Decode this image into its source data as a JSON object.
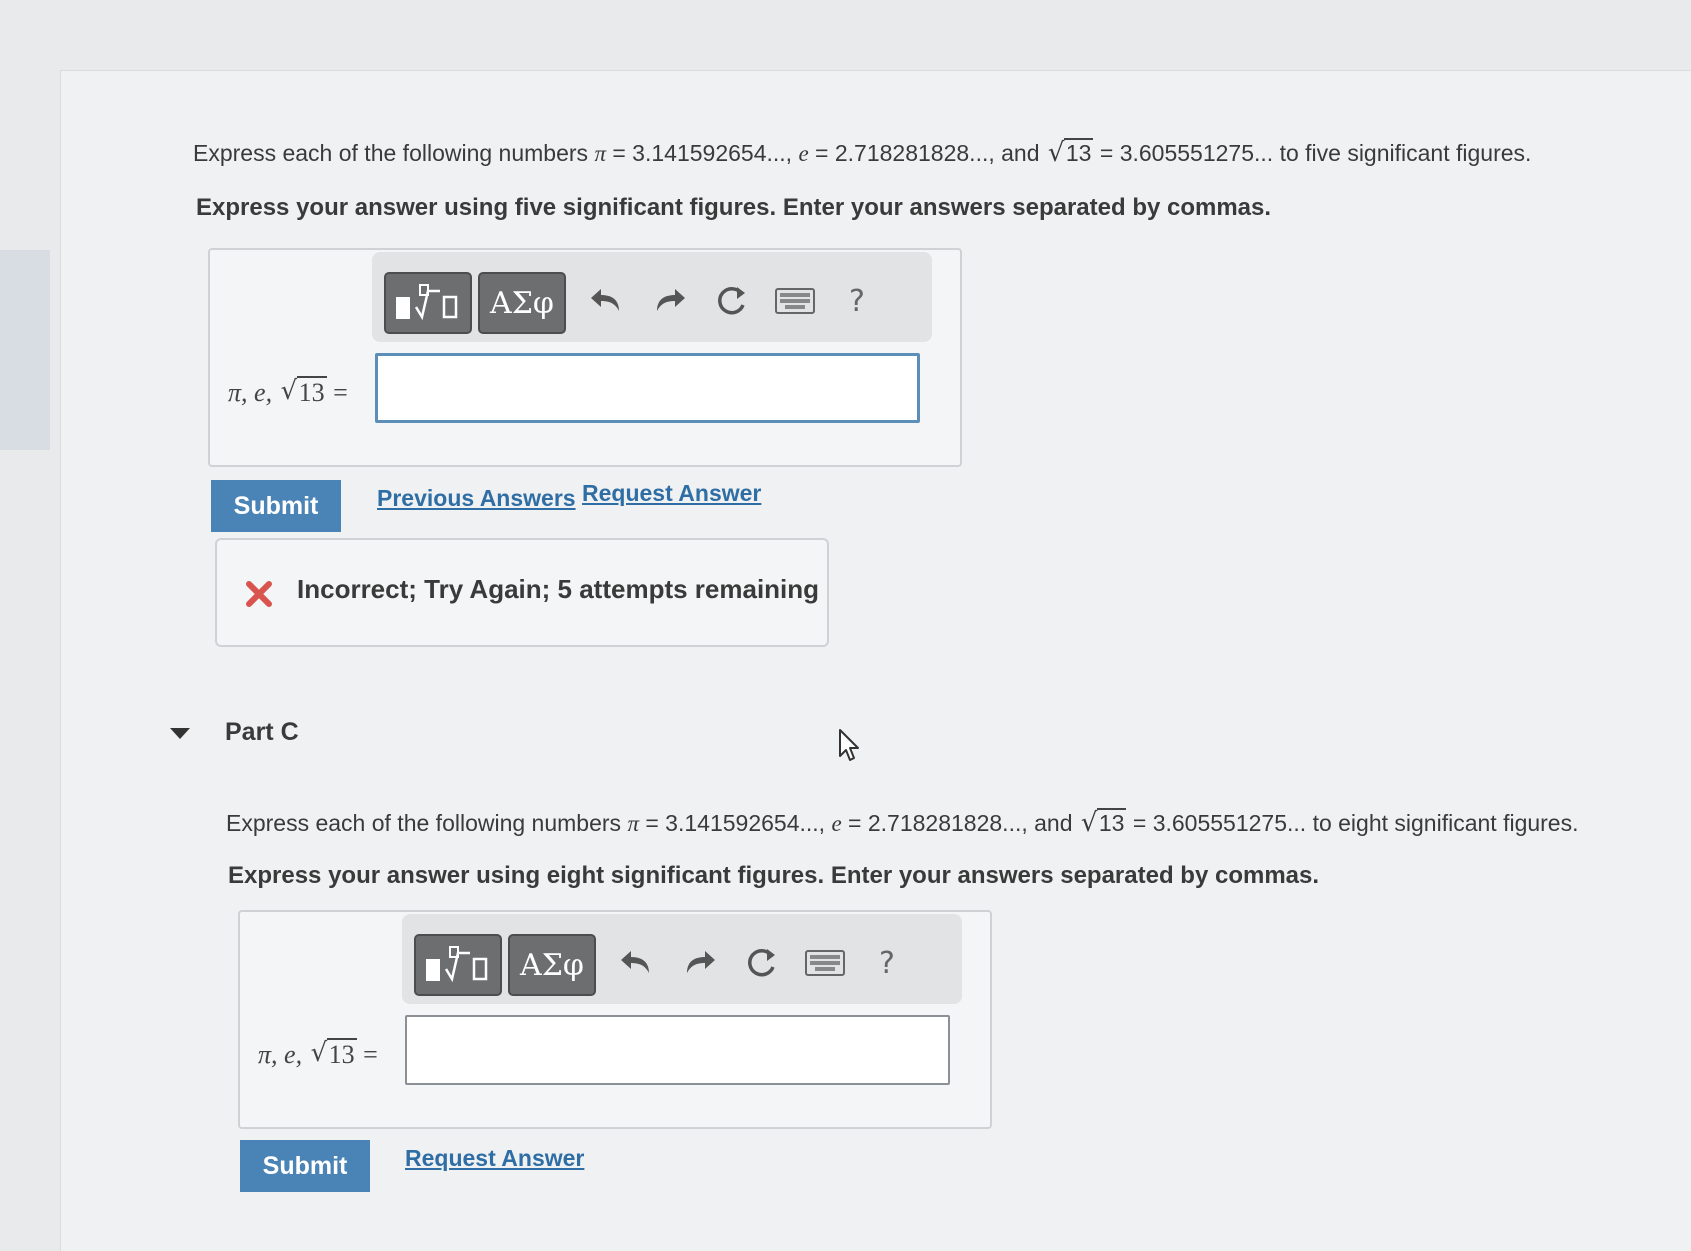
{
  "part_b": {
    "prompt_prefix": "Express each of the following numbers",
    "pi_value": "= 3.141592654...,",
    "e_value": "= 2.718281828...,",
    "and_text": "and",
    "sqrt_radicand": "13",
    "sqrt_value": "= 3.605551275... to five significant figures.",
    "instruction": "Express your answer using five significant figures. Enter your answers separated by commas.",
    "toolbar": {
      "greek": "ΑΣφ",
      "help": "?"
    },
    "input_label_prefix": "π, e,",
    "input_label_suffix": "=",
    "input_value": "",
    "submit_label": "Submit",
    "previous_answers": "Previous Answers",
    "request_answer": "Request Answer",
    "feedback": "Incorrect; Try Again; 5 attempts remaining"
  },
  "part_c": {
    "title": "Part C",
    "prompt_prefix": "Express each of the following numbers",
    "pi_value": "= 3.141592654...,",
    "e_value": "= 2.718281828...,",
    "and_text": "and",
    "sqrt_radicand": "13",
    "sqrt_value": "= 3.605551275... to eight significant figures.",
    "instruction": "Express your answer using eight significant figures. Enter your answers separated by commas.",
    "toolbar": {
      "greek": "ΑΣφ",
      "help": "?"
    },
    "input_label_prefix": "π, e,",
    "input_label_suffix": "=",
    "input_value": "",
    "submit_label": "Submit",
    "request_answer": "Request Answer"
  },
  "icons": {
    "templates": "templates-icon",
    "undo": "undo-icon",
    "redo": "redo-icon",
    "reset": "reset-icon",
    "keyboard": "keyboard-icon",
    "incorrect": "x-mark-icon",
    "cursor": "mouse-cursor-icon"
  },
  "colors": {
    "accent": "#4a83b5",
    "link": "#2f6ea5",
    "error": "#d9534f"
  }
}
